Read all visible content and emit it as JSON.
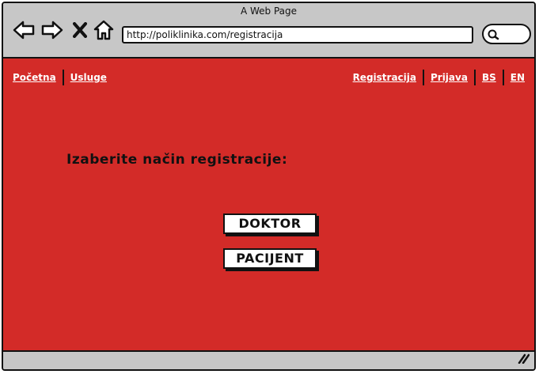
{
  "window": {
    "title": "A Web Page"
  },
  "browser": {
    "url": "http://poliklinika.com/registracija",
    "icons": [
      "back-arrow-icon",
      "forward-arrow-icon",
      "close-x-icon",
      "home-icon",
      "search-icon"
    ]
  },
  "nav": {
    "left": [
      "Početna",
      "Usluge"
    ],
    "right": [
      "Registracija",
      "Prijava",
      "BS",
      "EN"
    ]
  },
  "main": {
    "heading": "Izaberite način registracije:",
    "buttons": [
      "DOKTOR",
      "PACIJENT"
    ]
  },
  "colors": {
    "content_bg": "#d32b28",
    "chrome_bg": "#c7c7c7",
    "link": "#ffffff"
  }
}
